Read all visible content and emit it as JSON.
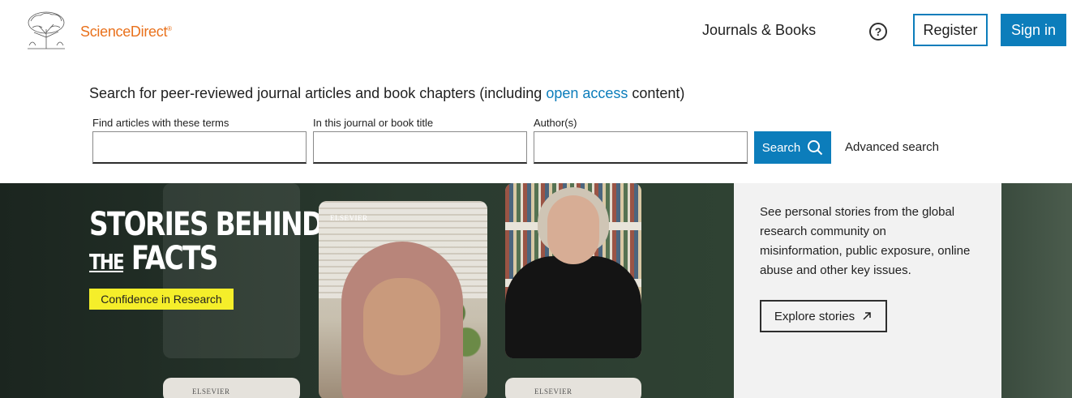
{
  "header": {
    "logo_text": "ScienceDirect",
    "logo_tm": "®",
    "nav_journals_books": "Journals & Books",
    "help_symbol": "?",
    "register_label": "Register",
    "signin_label": "Sign in"
  },
  "search": {
    "heading_prefix": "Search for peer-reviewed journal articles and book chapters (including ",
    "heading_link": "open access",
    "heading_suffix": " content)",
    "fields": [
      {
        "label": "Find articles with these terms",
        "value": "",
        "placeholder": ""
      },
      {
        "label": "In this journal or book title",
        "value": "",
        "placeholder": ""
      },
      {
        "label": "Author(s)",
        "value": "",
        "placeholder": ""
      }
    ],
    "search_button_label": "Search",
    "advanced_search_label": "Advanced search"
  },
  "banner": {
    "title_line1": "STORIES BEHIND",
    "title_the": "THE",
    "title_line2": "FACTS",
    "badge": "Confidence in Research",
    "elsevier_mark": "ELSEVIER",
    "panel_text": "See personal stories from the global research community on misinformation, public exposure, online abuse and other key issues.",
    "explore_label": "Explore stories"
  },
  "colors": {
    "brand_orange": "#e9711c",
    "accent_blue": "#0c7dbb",
    "badge_yellow": "#f5ee2a",
    "banner_dark": "#1b251f"
  },
  "icons": {
    "search": "search-icon",
    "external": "arrow-up-right-icon",
    "help": "help-icon",
    "logo": "elsevier-tree-logo"
  }
}
